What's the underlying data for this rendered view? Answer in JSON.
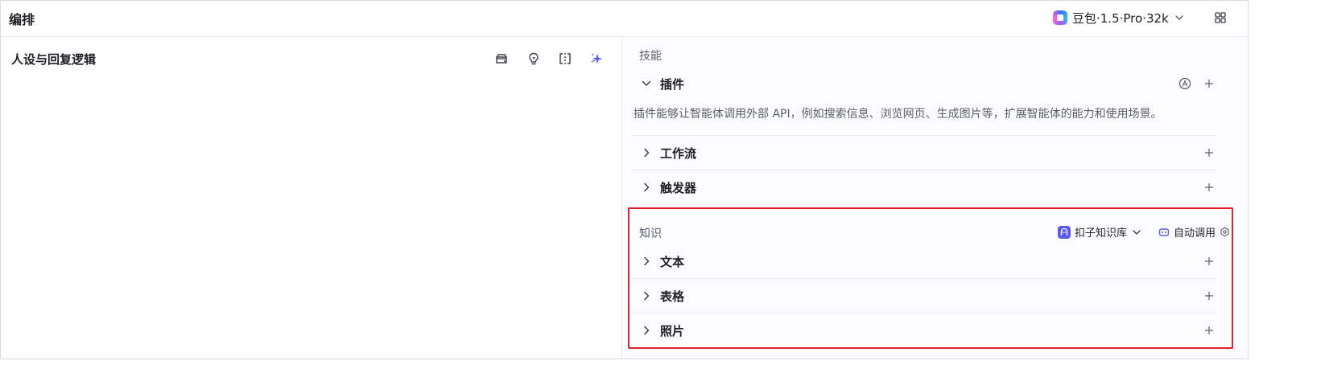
{
  "header": {
    "title": "编排",
    "model_name": "豆包·1.5·Pro·32k"
  },
  "left": {
    "title": "人设与回复逻辑"
  },
  "skills": {
    "label": "技能",
    "plugin": {
      "name": "插件",
      "description": "插件能够让智能体调用外部 API，例如搜索信息、浏览网页、生成图片等，扩展智能体的能力和使用场景。"
    },
    "workflow": {
      "name": "工作流"
    },
    "trigger": {
      "name": "触发器"
    }
  },
  "knowledge": {
    "label": "知识",
    "kb_source": "扣子知识库",
    "auto_call": "自动调用",
    "items": [
      {
        "name": "文本"
      },
      {
        "name": "表格"
      },
      {
        "name": "照片"
      }
    ]
  },
  "colors": {
    "accent": "#5a5cf0",
    "highlight": "#e0202c",
    "border": "#ebecf0"
  },
  "icons": {
    "model": "doubao-logo-icon",
    "apps": "grid-icon",
    "prompt_tools": [
      "prompt-library-icon",
      "bulb-icon",
      "compare-icon",
      "sparkle-icon"
    ]
  }
}
